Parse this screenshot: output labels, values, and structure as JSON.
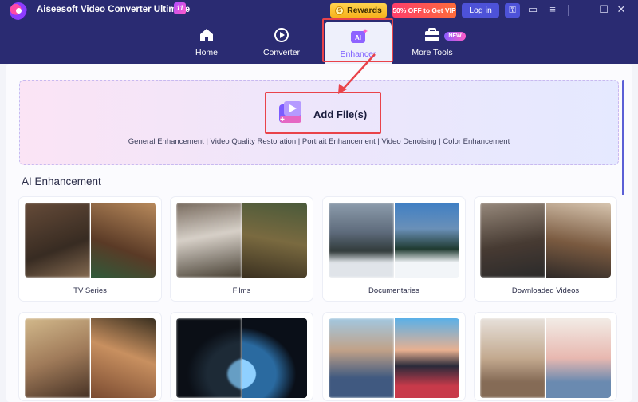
{
  "app": {
    "title": "Aiseesoft Video Converter Ultimate",
    "version_badge": "11"
  },
  "header": {
    "rewards_label": "Rewards",
    "vip_label": "50% OFF to Get VIP",
    "login_label": "Log in"
  },
  "tabs": [
    {
      "label": "Home",
      "icon": "home-icon"
    },
    {
      "label": "Converter",
      "icon": "converter-icon"
    },
    {
      "label": "Enhancer",
      "icon": "ai-enhancer-icon"
    },
    {
      "label": "More Tools",
      "icon": "toolbox-icon",
      "badge": "NEW"
    }
  ],
  "dropzone": {
    "add_label": "Add File(s)",
    "features": "General Enhancement | Video Quality Restoration | Portrait Enhancement | Video Denoising | Color Enhancement"
  },
  "section": {
    "title": "AI Enhancement"
  },
  "cards": [
    {
      "label": "TV Series"
    },
    {
      "label": "Films"
    },
    {
      "label": "Documentaries"
    },
    {
      "label": "Downloaded Videos"
    }
  ],
  "colors": {
    "header_bg": "#2a2b72",
    "accent": "#7b5cff",
    "highlight": "#e9434a"
  }
}
